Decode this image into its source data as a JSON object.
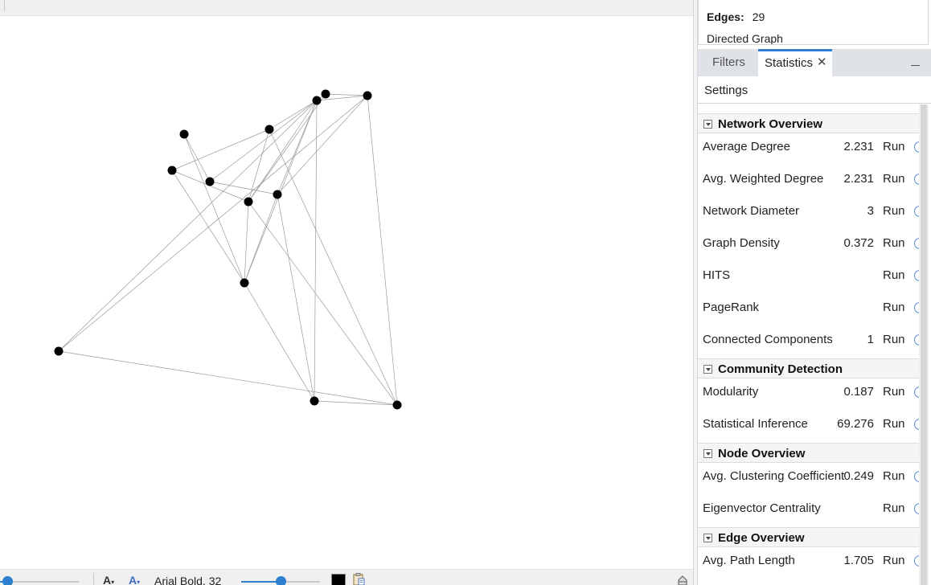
{
  "toolbar": {
    "font_label": "Arial Bold, 32",
    "font_size_decrease": "A",
    "font_size_increase": "A",
    "label_color": "#000000",
    "node_scale_level": 0.1,
    "label_size_level": 0.5
  },
  "context": {
    "edges_label": "Edges:",
    "edges_value": "29",
    "graph_type": "Directed Graph"
  },
  "tabs": {
    "filters": "Filters",
    "statistics": "Statistics",
    "close": "✕"
  },
  "settings_label": "Settings",
  "sections": {
    "network": "Network Overview",
    "community": "Community Detection",
    "node": "Node Overview",
    "edge": "Edge Overview"
  },
  "stats": [
    {
      "name": "Average Degree",
      "value": "2.231",
      "run": "Run"
    },
    {
      "name": "Avg. Weighted Degree",
      "value": "2.231",
      "run": "Run"
    },
    {
      "name": "Network Diameter",
      "value": "3",
      "run": "Run"
    },
    {
      "name": "Graph Density",
      "value": "0.372",
      "run": "Run"
    },
    {
      "name": "HITS",
      "value": "",
      "run": "Run"
    },
    {
      "name": "PageRank",
      "value": "",
      "run": "Run"
    },
    {
      "name": "Connected Components",
      "value": "1",
      "run": "Run"
    },
    {
      "name": "Modularity",
      "value": "0.187",
      "run": "Run"
    },
    {
      "name": "Statistical Inference",
      "value": "69.276",
      "run": "Run"
    },
    {
      "name": "Avg. Clustering Coefficient",
      "value": "0.249",
      "run": "Run"
    },
    {
      "name": "Eigenvector Centrality",
      "value": "",
      "run": "Run"
    },
    {
      "name": "Avg. Path Length",
      "value": "1.705",
      "run": "Run"
    }
  ],
  "colors": {
    "accent": "#2f7fd4",
    "node": "#000000",
    "edge": "#8a8a8a"
  }
}
